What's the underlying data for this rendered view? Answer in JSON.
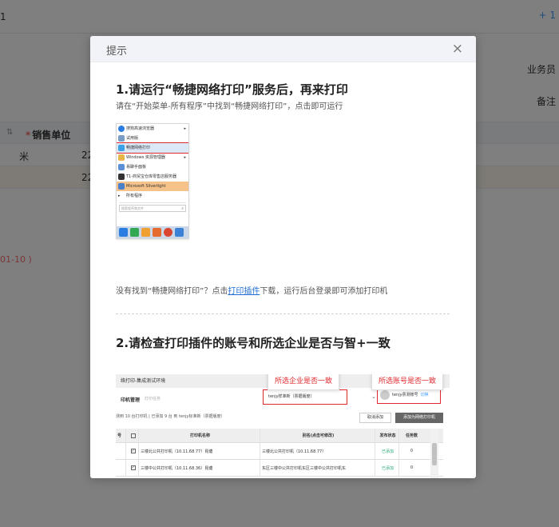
{
  "background": {
    "top_number": "1",
    "top_right": "+ 1",
    "field_salesman": "业务员",
    "field_remark": "备注",
    "table_sort_icon": "sort-icon",
    "table_required_mark": "*",
    "table_col_label": "销售单位",
    "row1_unit": "米",
    "row1_value": "22",
    "row2_value": "22",
    "range_text": "01-10 )"
  },
  "modal": {
    "title": "提示",
    "close_icon": "×",
    "step1": {
      "title": "1.请运行“畅捷网络打印”服务后，再来打印",
      "desc": "请在“开始菜单-所有程序”中找到“畅捷网络打印”，点击即可运行",
      "menu": {
        "items": [
          "搜狗高速浏览器",
          "试用版",
          "畅捷网络打印",
          "Windows 资源管理器",
          "易聊手面板",
          "T1-商贸宝仓库零售店服务器",
          "Microsoft Silverlight"
        ],
        "all_programs": "所有程序",
        "search_placeholder": "搜索程序和文件"
      },
      "tip_before": "没有找到“畅捷网络打印”？点击",
      "tip_link": "打印插件",
      "tip_after": "下载，运行后台登录即可添加打印机"
    },
    "step2": {
      "title": "2.请检查打印插件的账号和所选企业是否与智+一致",
      "plugin": {
        "header": "络打印-集成测试环境",
        "mgmt": "印机管理",
        "search": "打印任务",
        "select_value": "tenjy样准新（票据版度）",
        "account": "tenjy票测账号",
        "switch": "切换",
        "callout_company": "所选企业是否一致",
        "callout_account": "所选账号是否一致",
        "status": "测到 10 台打印机 | 已添加 9 台 到 tenjy标准新（票据版度）",
        "cancel_btn": "取消添加",
        "add_btn": "添加为网络打印机",
        "columns": [
          "号",
          "",
          "打印机名称",
          "别名(点击可修改)",
          "发布状态",
          "任务数"
        ],
        "rows": [
          {
            "no": "",
            "name": "三楼北公共打印机（10.11.68.77）昆塘",
            "alias": "三楼北公共打印机（10.11.68.77）",
            "status": "已添加",
            "tasks": "0"
          },
          {
            "no": "",
            "name": "三楼中公共打印机（10.11.68.36）昆塘",
            "alias": "东区三楼中公共打印机东区三楼中公共打印机东",
            "status": "已添加",
            "tasks": "0"
          }
        ]
      }
    }
  }
}
